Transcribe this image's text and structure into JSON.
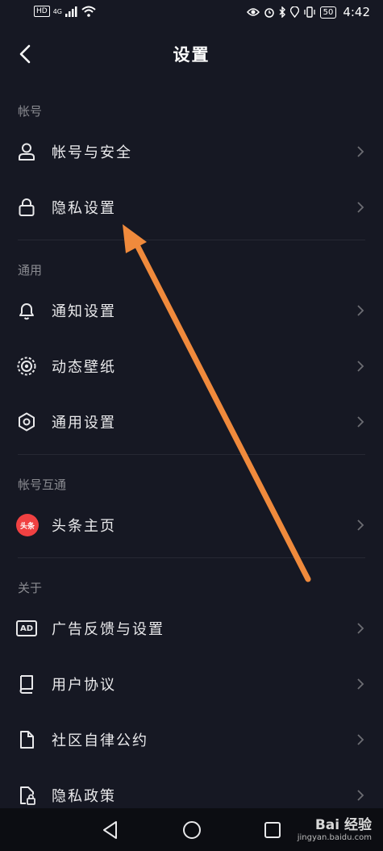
{
  "status_bar": {
    "hd_badge": "HD",
    "network": "4G",
    "battery": "50",
    "time": "4:42"
  },
  "header": {
    "title": "设置"
  },
  "sections": {
    "account": "帐号",
    "general": "通用",
    "interop": "帐号互通",
    "about": "关于"
  },
  "rows": {
    "account_security": "帐号与安全",
    "privacy_settings": "隐私设置",
    "notification_settings": "通知设置",
    "live_wallpaper": "动态壁纸",
    "general_settings": "通用设置",
    "toutiao_home": "头条主页",
    "ad_feedback": "广告反馈与设置",
    "user_agreement": "用户协议",
    "community_convention": "社区自律公约",
    "privacy_policy": "隐私政策"
  },
  "icons": {
    "toutiao_badge": "头条",
    "ad_badge": "AD"
  },
  "watermark": {
    "logo": "Bai 经验",
    "url": "jingyan.baidu.com"
  },
  "colors": {
    "background": "#161823",
    "annotation_arrow": "#f08a3c"
  }
}
